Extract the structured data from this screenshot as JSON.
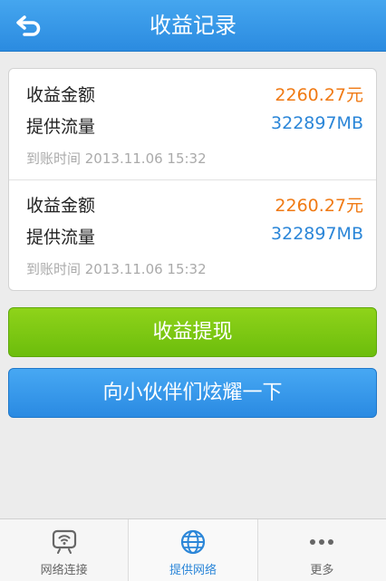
{
  "header": {
    "title": "收益记录",
    "back_icon": "back-arrow-icon"
  },
  "records": [
    {
      "amount_label": "收益金额",
      "amount_value": "2260.27元",
      "traffic_label": "提供流量",
      "traffic_value": "322897MB",
      "time": "到账时间 2013.11.06  15:32"
    },
    {
      "amount_label": "收益金额",
      "amount_value": "2260.27元",
      "traffic_label": "提供流量",
      "traffic_value": "322897MB",
      "time": "到账时间 2013.11.06  15:32"
    }
  ],
  "buttons": {
    "withdraw_label": "收益提现",
    "share_label": "向小伙伴们炫耀一下"
  },
  "tabbar": {
    "tabs": [
      {
        "label": "网络连接",
        "icon": "wifi-monitor-icon",
        "active": false
      },
      {
        "label": "提供网络",
        "icon": "globe-icon",
        "active": true
      },
      {
        "label": "更多",
        "icon": "more-dots-icon",
        "active": false
      }
    ]
  },
  "colors": {
    "header": "#2b8be0",
    "amount": "#f07a14",
    "traffic": "#2b86d8",
    "green_button": "#6cbd0c",
    "blue_button": "#2a8ae2",
    "active_tab": "#2b86d8"
  }
}
